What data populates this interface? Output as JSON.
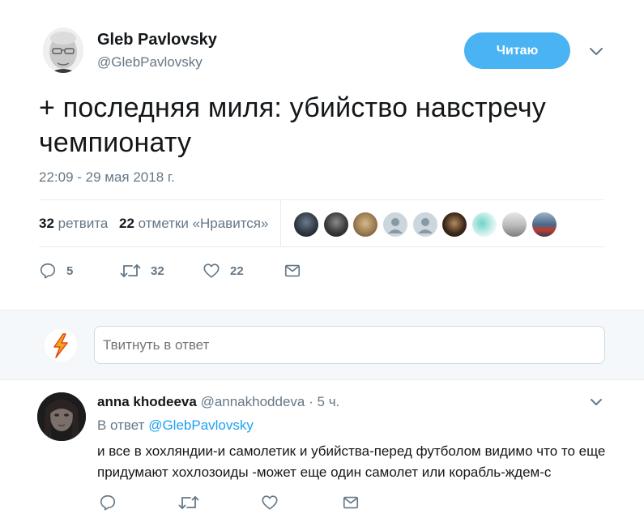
{
  "tweet": {
    "author_name": "Gleb Pavlovsky",
    "author_handle": "@GlebPavlovsky",
    "follow_label": "Читаю",
    "text": "+ последняя миля: убийство навстречу чемпионату",
    "timestamp": "22:09 - 29 мая 2018 г.",
    "retweets_count": "32",
    "retweets_label": "ретвита",
    "likes_count": "22",
    "likes_label": "отметки «Нравится»",
    "actions": {
      "replies": "5",
      "retweets": "32",
      "likes": "22"
    },
    "icons": [
      "reply-icon",
      "retweet-icon",
      "like-icon",
      "direct-message-icon",
      "chevron-down-icon"
    ]
  },
  "compose": {
    "placeholder": "Твитнуть в ответ"
  },
  "reply": {
    "author_name": "anna khodeeva",
    "author_handle": "@annakhoddeva",
    "separator": "·",
    "time": "5 ч.",
    "in_reply_prefix": "В ответ",
    "in_reply_handle": "@GlebPavlovsky",
    "text": "и все в хохляндии-и самолетик и убийства-перед футболом видимо что то еще придумают хохлозоиды -может еще один самолет или корабль-ждем-с"
  },
  "colors": {
    "accent": "#1da1f2",
    "follow_button": "#4ab3f4",
    "muted_text": "#657786",
    "border": "#e6ecf0",
    "compose_background": "#f5f8fa"
  }
}
